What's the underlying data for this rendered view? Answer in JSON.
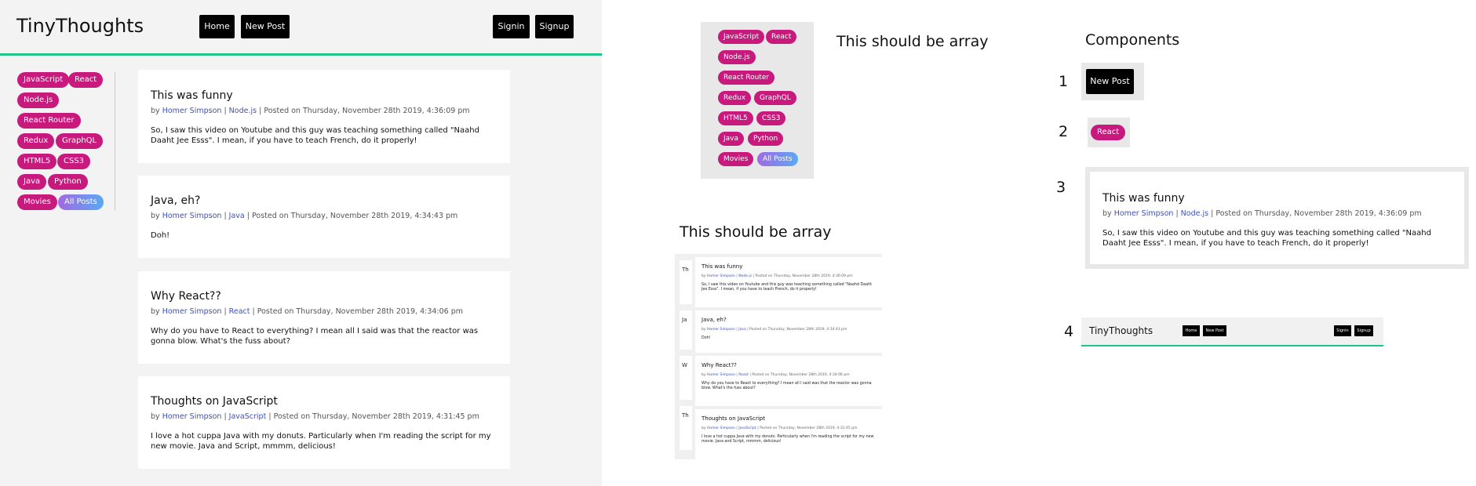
{
  "app": {
    "title": "TinyThoughts",
    "nav": {
      "home": "Home",
      "new_post": "New Post"
    },
    "auth": {
      "signin": "Signin",
      "signup": "Signup"
    },
    "accent_color": "#22c48a",
    "tag_color": "#c8197d",
    "tags": [
      "JavaScript",
      "React",
      "Node.js",
      "React Router",
      "Redux",
      "GraphQL",
      "HTML5",
      "CSS3",
      "Java",
      "Python",
      "Movies",
      "All Posts"
    ],
    "posts": [
      {
        "title": "This was funny",
        "by": "by",
        "author": "Homer Simpson",
        "sep1": "|",
        "category": "Node.js",
        "sep2": "|",
        "posted": "Posted on Thursday, November 28th 2019, 4:36:09 pm",
        "body": "So, I saw this video on Youtube and this guy was teaching something called \"Naahd Daaht Jee Esss\". I mean, if you have to teach French, do it properly!"
      },
      {
        "title": "Java, eh?",
        "by": "by",
        "author": "Homer Simpson",
        "sep1": "|",
        "category": "Java",
        "sep2": "|",
        "posted": "Posted on Thursday, November 28th 2019, 4:34:43 pm",
        "body": "Doh!"
      },
      {
        "title": "Why React??",
        "by": "by",
        "author": "Homer Simpson",
        "sep1": "|",
        "category": "React",
        "sep2": "|",
        "posted": "Posted on Thursday, November 28th 2019, 4:34:06 pm",
        "body": "Why do you have to React to everything? I mean all I said was that the reactor was gonna blow. What's the fuss about?"
      },
      {
        "title": "Thoughts on JavaScript",
        "by": "by",
        "author": "Homer Simpson",
        "sep1": "|",
        "category": "JavaScript",
        "sep2": "|",
        "posted": "Posted on Thursday, November 28th 2019, 4:31:45 pm",
        "body": "I love a hot cuppa Java with my donuts. Particularly when I'm reading the script for my new movie. Java and Script, mmmm, delicious!"
      }
    ]
  },
  "annotations": {
    "array_label_1": "This should be array",
    "array_label_2": "This should be array",
    "components_heading": "Components",
    "items": [
      "1",
      "2",
      "3",
      "4"
    ],
    "example_button": "New Post",
    "example_tag": "React",
    "header_example": {
      "title": "TinyThoughts",
      "home": "Home",
      "new_post": "New Post",
      "signin": "Signin",
      "signup": "Signup"
    },
    "ghost_letters": [
      "Th",
      "Ja",
      "W",
      "Th"
    ]
  }
}
